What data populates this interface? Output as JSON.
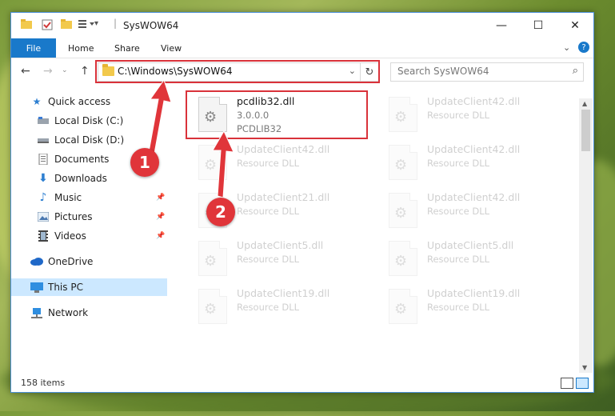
{
  "window": {
    "title": "SysWOW64"
  },
  "ribbon": {
    "tabs": [
      "File",
      "Home",
      "Share",
      "View"
    ]
  },
  "navigation": {
    "address": "C:\\Windows\\SysWOW64",
    "search_placeholder": "Search SysWOW64"
  },
  "sidebar": {
    "items": [
      {
        "label": "Quick access",
        "icon": "star-icon"
      },
      {
        "label": "Local Disk (C:)",
        "icon": "drive-icon"
      },
      {
        "label": "Local Disk (D:)",
        "icon": "drive-icon"
      },
      {
        "label": "Documents",
        "icon": "documents-icon"
      },
      {
        "label": "Downloads",
        "icon": "download-icon"
      },
      {
        "label": "Music",
        "icon": "music-icon"
      },
      {
        "label": "Pictures",
        "icon": "pictures-icon"
      },
      {
        "label": "Videos",
        "icon": "videos-icon"
      },
      {
        "label": "OneDrive",
        "icon": "cloud-icon"
      },
      {
        "label": "This PC",
        "icon": "computer-icon"
      },
      {
        "label": "Network",
        "icon": "network-icon"
      }
    ]
  },
  "files": {
    "highlighted": {
      "name": "pcdlib32.dll",
      "version": "3.0.0.0",
      "description": "PCDLIB32"
    },
    "background": [
      {
        "name": "UpdateClient42.dll",
        "description": "Resource DLL"
      },
      {
        "name": "UpdateClient42.dll",
        "description": "Resource DLL"
      },
      {
        "name": "UpdateClient42.dll",
        "description": "Resource DLL"
      },
      {
        "name": "UpdateClient21.dll",
        "description": "Resource DLL"
      },
      {
        "name": "UpdateClient42.dll",
        "description": "Resource DLL"
      },
      {
        "name": "UpdateClient5.dll",
        "description": "Resource DLL"
      },
      {
        "name": "UpdateClient5.dll",
        "description": "Resource DLL"
      },
      {
        "name": "UpdateClient19.dll",
        "description": "Resource DLL"
      },
      {
        "name": "UpdateClient19.dll",
        "description": "Resource DLL"
      }
    ]
  },
  "status": {
    "item_count": "158 items"
  },
  "callouts": [
    "1",
    "2"
  ],
  "colors": {
    "accent": "#1979ca",
    "selection": "#cce8ff",
    "annotation": "#d9323a"
  }
}
